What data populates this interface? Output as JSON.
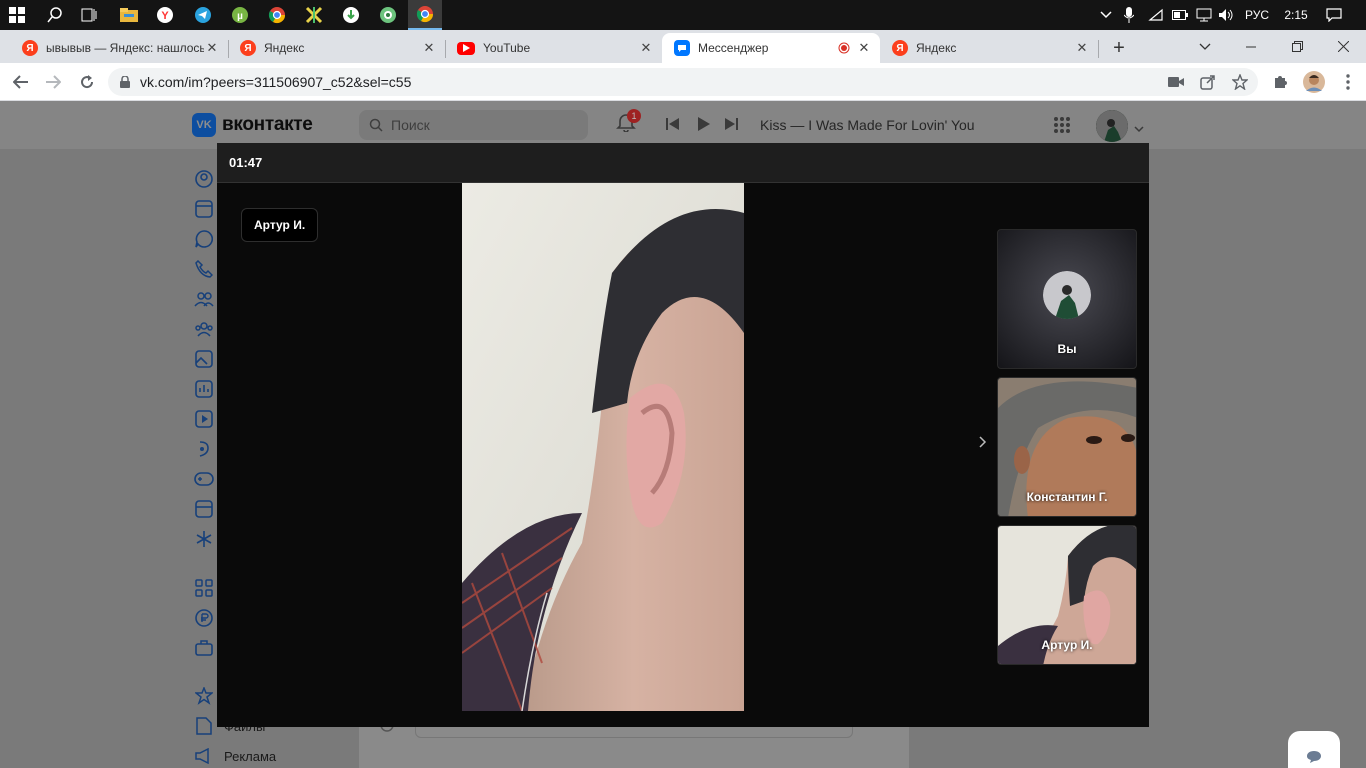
{
  "browser": {
    "tabs": [
      {
        "title": "ывывыв — Яндекс: нашлось",
        "favicon": "yandex-icon"
      },
      {
        "title": "Яндекс",
        "favicon": "yandex-icon"
      },
      {
        "title": "YouTube",
        "favicon": "youtube-icon"
      },
      {
        "title": "Мессенджер",
        "favicon": "vk-messenger-icon",
        "active": true,
        "recording": true
      },
      {
        "title": "Яндекс",
        "favicon": "yandex-icon"
      }
    ],
    "url": "vk.com/im?peers=311506907_c52&sel=c55"
  },
  "system": {
    "language": "РУС",
    "time": "2:15"
  },
  "vk": {
    "logo_text": "вконтакте",
    "search_placeholder": "Поиск",
    "notifications_count": "1",
    "now_playing": "Kiss — I Was Made For Lovin' You",
    "sidebar_bottom": [
      "Файлы",
      "Реклама"
    ]
  },
  "call": {
    "timer": "01:47",
    "active_speaker": "Артур И.",
    "participants": [
      {
        "name": "Вы"
      },
      {
        "name": "Константин Г."
      },
      {
        "name": "Артур И."
      }
    ]
  },
  "colors": {
    "vk_blue": "#0077ff",
    "call_bg": "#0a0a0a",
    "taskbar": "#141414"
  }
}
